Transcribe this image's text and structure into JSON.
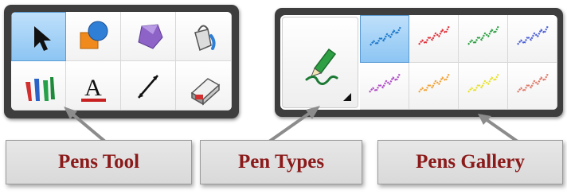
{
  "left_toolbar": {
    "tools": [
      {
        "icon": "arrow-select-icon",
        "selected": true
      },
      {
        "icon": "shapes-icon",
        "selected": false
      },
      {
        "icon": "polygon-icon",
        "selected": false
      },
      {
        "icon": "fill-bucket-icon",
        "selected": false
      },
      {
        "icon": "pens-tool-icon",
        "selected": false
      },
      {
        "icon": "text-tool-icon",
        "selected": false,
        "label": "A"
      },
      {
        "icon": "line-tool-icon",
        "selected": false
      },
      {
        "icon": "eraser-icon",
        "selected": false
      }
    ]
  },
  "right_toolbar": {
    "pen_types_button": {
      "icon": "pen-with-squiggle-icon",
      "has_dropdown": true
    },
    "gallery": [
      {
        "icon": "pen-stroke-sample-icon",
        "color": "#1e78c8",
        "selected": true
      },
      {
        "icon": "pen-stroke-sample-icon",
        "color": "#e0303a",
        "selected": false
      },
      {
        "icon": "pen-stroke-sample-icon",
        "color": "#2ea043",
        "selected": false
      },
      {
        "icon": "pen-stroke-sample-icon",
        "color": "#4a5fd6",
        "selected": false
      },
      {
        "icon": "pen-stroke-sample-icon",
        "color": "#b04cc8",
        "selected": false
      },
      {
        "icon": "pen-stroke-sample-icon",
        "color": "#f2a43a",
        "selected": false
      },
      {
        "icon": "pen-stroke-sample-icon",
        "color": "#e8e233",
        "selected": false
      },
      {
        "icon": "pen-stroke-sample-icon",
        "color": "#e07a6a",
        "selected": false
      }
    ]
  },
  "callouts": {
    "pens_tool": "Pens Tool",
    "pen_types": "Pen Types",
    "pens_gallery": "Pens Gallery"
  },
  "colors": {
    "callout_text": "#8b1a1a",
    "arrow": "#8c8c8c",
    "selection": "#8cc5f3"
  }
}
